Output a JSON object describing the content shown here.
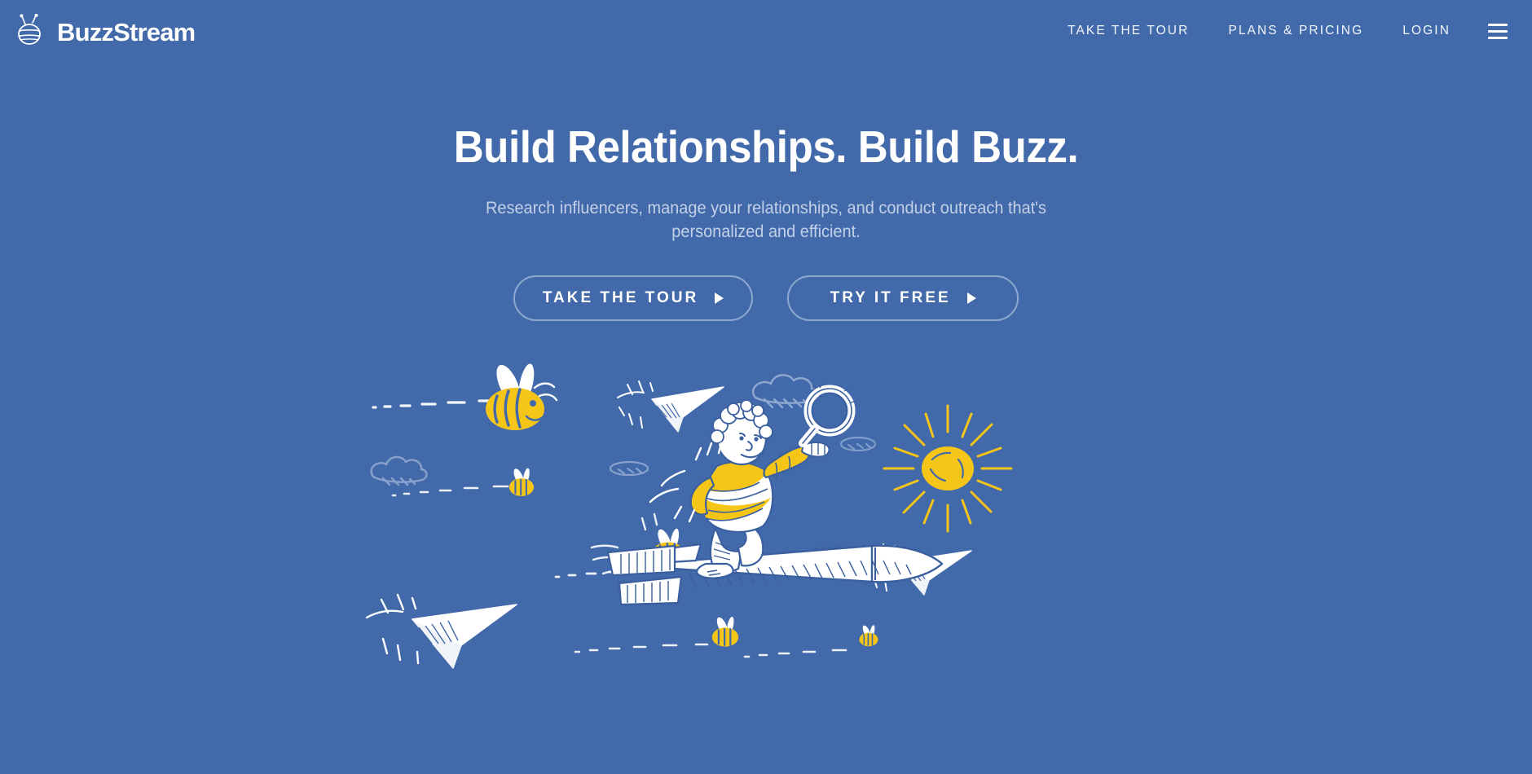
{
  "page": {
    "background_color": "#4269aa",
    "accent_yellow": "#f5c518",
    "text_color": "#ffffff",
    "muted_text_color": "#c3d1e8"
  },
  "header": {
    "brand": {
      "name": "BuzzStream",
      "logo_icon": "bee-logo-icon"
    },
    "nav": [
      {
        "label": "TAKE THE TOUR",
        "name": "nav-take-the-tour"
      },
      {
        "label": "PLANS & PRICING",
        "name": "nav-plans-pricing"
      },
      {
        "label": "LOGIN",
        "name": "nav-login"
      }
    ],
    "menu_toggle_icon": "hamburger-menu-icon"
  },
  "hero": {
    "title": "Build Relationships. Build Buzz.",
    "subtitle": "Research influencers, manage your relationships, and conduct outreach that's personalized and efficient.",
    "buttons": [
      {
        "label": "TAKE THE TOUR",
        "icon": "play-triangle-icon",
        "name": "hero-take-the-tour-button"
      },
      {
        "label": "TRY IT FREE",
        "icon": "play-triangle-icon",
        "name": "hero-try-it-free-button"
      }
    ],
    "illustration": {
      "description": "Hand-drawn scene: a boy in a yellow striped shirt rides a rocket holding a magnifying glass, surrounded by flying bees, paper airplanes, clouds and a sun.",
      "elements": [
        "boy-on-rocket",
        "magnifying-glass",
        "bee-large",
        "bee-small-left",
        "bee-small-center",
        "bee-small-right",
        "paper-airplane-top",
        "paper-airplane-right",
        "paper-airplane-bottom-left",
        "cloud-left",
        "cloud-top",
        "cloud-small-center",
        "cloud-small-right",
        "sun"
      ]
    }
  }
}
